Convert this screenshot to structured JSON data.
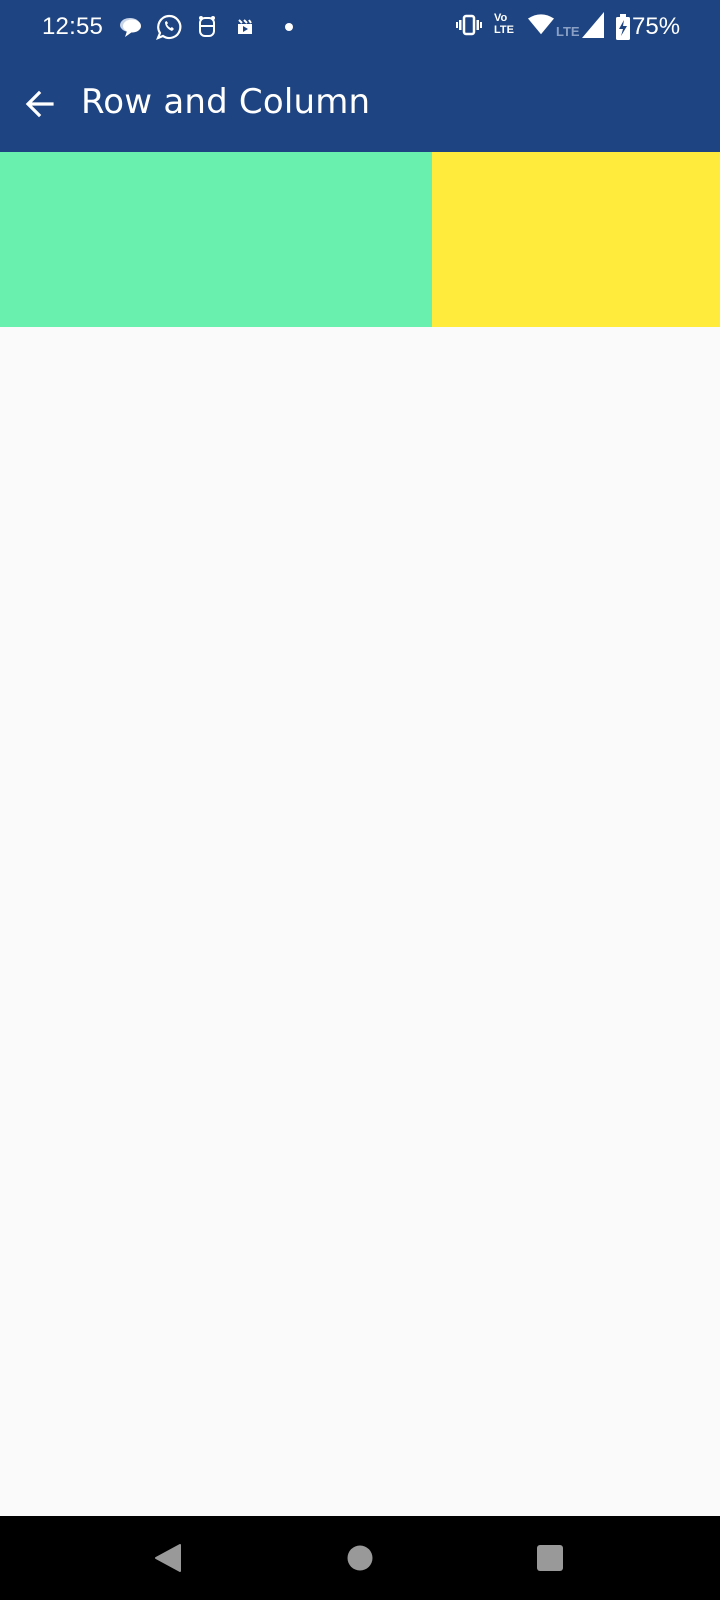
{
  "status_bar": {
    "time": "12:55",
    "notification_icons": [
      "chat-bubbles-icon",
      "whatsapp-icon",
      "robot-face-icon",
      "video-clip-icon",
      "more-dot-icon"
    ],
    "system_icons": [
      "vibrate-icon",
      "volte-icon",
      "wifi-icon",
      "lte-signal-icon",
      "battery-charging-icon"
    ],
    "volte_label_top": "Vo",
    "volte_label_bottom": "LTE",
    "lte_label": "LTE",
    "battery": "75%"
  },
  "app_bar": {
    "title": "Row and Column",
    "back_icon": "arrow-back-icon",
    "color": "#1e4482"
  },
  "row": {
    "blocks": [
      {
        "name": "green-block",
        "color": "#69f0ae"
      },
      {
        "name": "yellow-block",
        "color": "#ffeb3b"
      }
    ]
  },
  "nav_bar": {
    "buttons": [
      "back-triangle-icon",
      "home-circle-icon",
      "recents-square-icon"
    ]
  }
}
